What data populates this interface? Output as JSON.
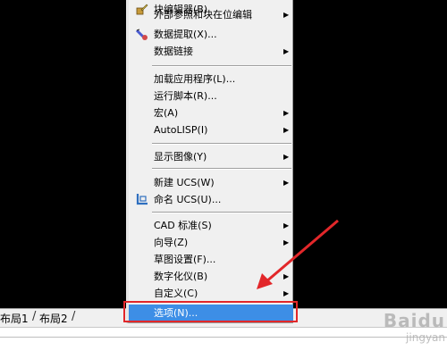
{
  "menu": {
    "items": [
      {
        "label": "块编辑器(B)",
        "arrow": false,
        "icon": "block-editor-icon"
      },
      {
        "label": "外部参照和块在位编辑",
        "arrow": true,
        "icon": ""
      },
      {
        "label": "数据提取(X)...",
        "arrow": false,
        "icon": "data-extraction-icon"
      },
      {
        "label": "数据链接",
        "arrow": true,
        "icon": ""
      },
      {
        "label": "加载应用程序(L)...",
        "arrow": false,
        "icon": ""
      },
      {
        "label": "运行脚本(R)...",
        "arrow": false,
        "icon": ""
      },
      {
        "label": "宏(A)",
        "arrow": true,
        "icon": ""
      },
      {
        "label": "AutoLISP(I)",
        "arrow": true,
        "icon": ""
      },
      {
        "label": "显示图像(Y)",
        "arrow": true,
        "icon": ""
      },
      {
        "label": "新建 UCS(W)",
        "arrow": true,
        "icon": ""
      },
      {
        "label": "命名 UCS(U)...",
        "arrow": false,
        "icon": "named-ucs-icon"
      },
      {
        "label": "CAD 标准(S)",
        "arrow": true,
        "icon": ""
      },
      {
        "label": "向导(Z)",
        "arrow": true,
        "icon": ""
      },
      {
        "label": "草图设置(F)...",
        "arrow": false,
        "icon": ""
      },
      {
        "label": "数字化仪(B)",
        "arrow": true,
        "icon": ""
      },
      {
        "label": "自定义(C)",
        "arrow": true,
        "icon": ""
      },
      {
        "label": "选项(N)...",
        "arrow": false,
        "icon": "",
        "selected": true
      }
    ],
    "arrow_glyph": "▶"
  },
  "layout_tabs": {
    "tab1": "布局1",
    "tab2": "布局2",
    "divider": "/"
  },
  "colors": {
    "selection": "#3d8ee6",
    "annotation": "#e2272a",
    "canvas": "#000000"
  },
  "watermark": {
    "line1": "Baidu",
    "line2": "jingyan"
  }
}
